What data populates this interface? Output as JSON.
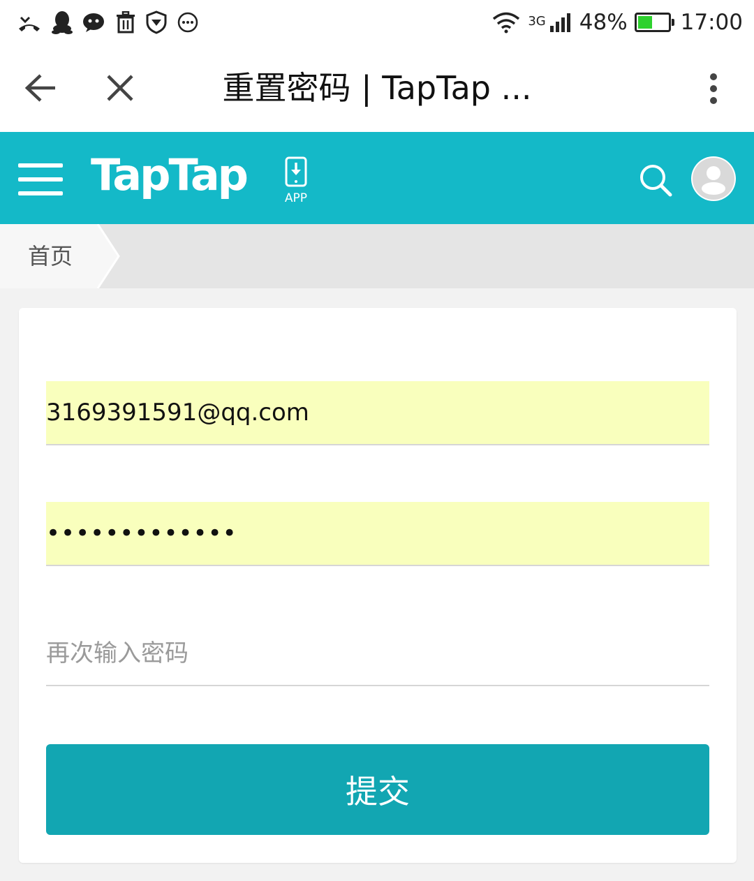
{
  "status_bar": {
    "left_icons": [
      "missed-call-icon",
      "qq-icon",
      "wechat-icon",
      "trash-icon",
      "shield-icon",
      "more-circle-icon"
    ],
    "network_type": "3G",
    "battery_percent": "48%",
    "battery_level": 0.48,
    "battery_color": "#2ed12e",
    "time": "17:00"
  },
  "browser": {
    "title": "重置密码 | TapTap ..."
  },
  "header": {
    "logo_text": "TapTap",
    "app_label": "APP",
    "brand_color": "#14b9c8"
  },
  "breadcrumb": {
    "home": "首页"
  },
  "form": {
    "email_value": "3169391591@qq.com",
    "password_value": "•••••••••••••",
    "confirm_placeholder": "再次输入密码",
    "submit_label": "提交",
    "button_color": "#12a6b2",
    "autofill_color": "#f9ffbd"
  }
}
